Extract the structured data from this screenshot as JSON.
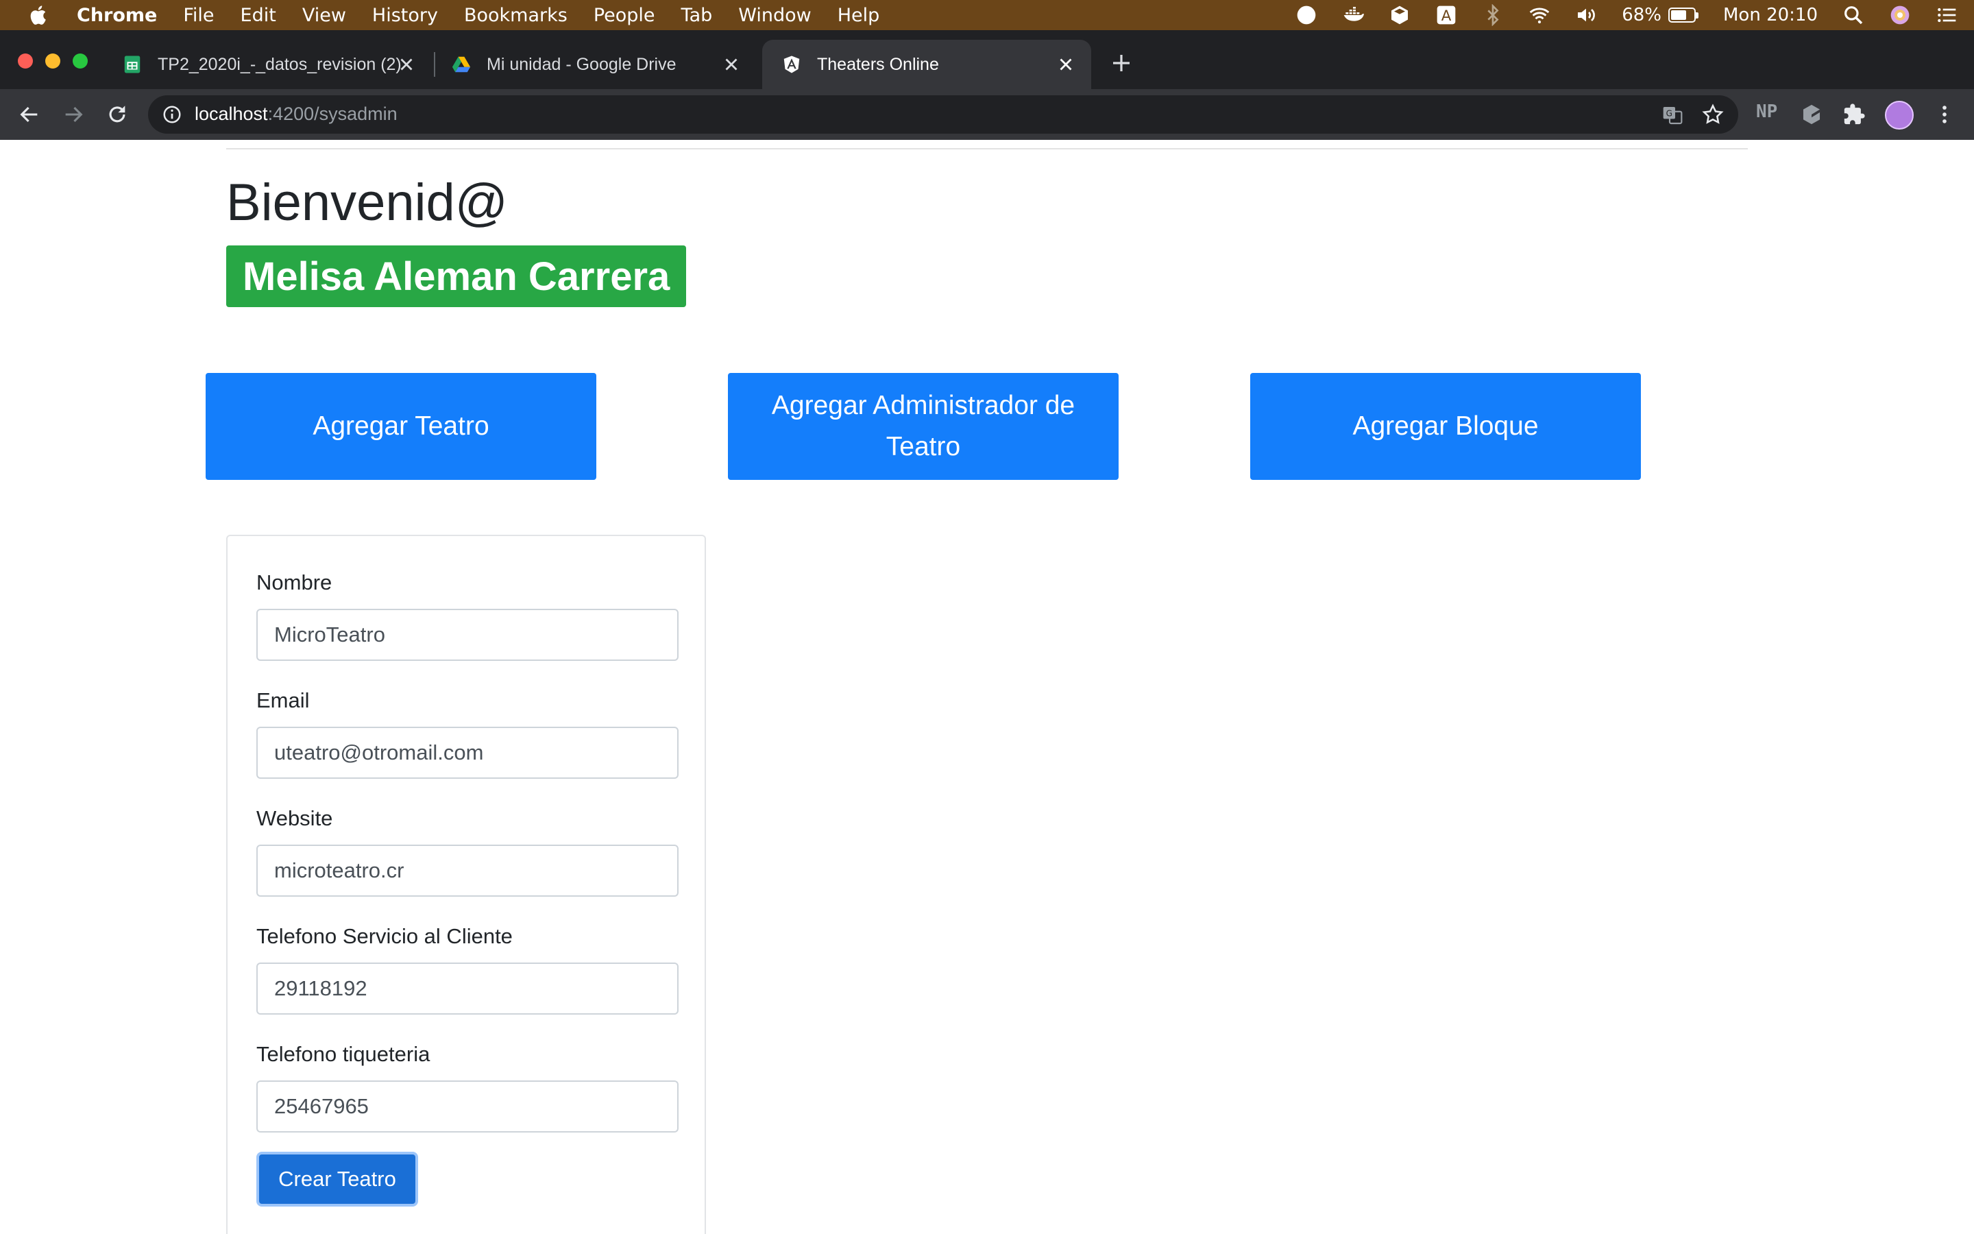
{
  "menubar": {
    "app": "Chrome",
    "items": [
      "File",
      "Edit",
      "View",
      "History",
      "Bookmarks",
      "People",
      "Tab",
      "Window",
      "Help"
    ],
    "battery_percent": "68%",
    "battery_level": 0.68,
    "clock": "Mon 20:10"
  },
  "browser": {
    "tabs": [
      {
        "title": "TP2_2020i_-_datos_revision (2)",
        "favicon": "google-sheets-icon"
      },
      {
        "title": "Mi unidad - Google Drive",
        "favicon": "google-drive-icon"
      },
      {
        "title": "Theaters Online",
        "favicon": "angular-icon",
        "active": true
      }
    ],
    "url_host": "localhost",
    "url_path": ":4200/sysadmin",
    "extension_label": "NP"
  },
  "page": {
    "welcome": "Bienvenid@",
    "user_name": "Melisa Aleman Carrera",
    "actions": {
      "add_theater": "Agregar Teatro",
      "add_admin": "Agregar Administrador de Teatro",
      "add_block": "Agregar Bloque"
    },
    "form": {
      "nombre_label": "Nombre",
      "nombre_value": "MicroTeatro",
      "email_label": "Email",
      "email_value": "uteatro@otromail.com",
      "website_label": "Website",
      "website_value": "microteatro.cr",
      "telefono_servicio_label": "Telefono Servicio al Cliente",
      "telefono_servicio_value": "29118192",
      "telefono_tiqueteria_label": "Telefono tiqueteria",
      "telefono_tiqueteria_value": "25467965",
      "submit_label": "Crear Teatro"
    }
  },
  "colors": {
    "menubar": "#6b4518",
    "primary": "#147efb",
    "success": "#28a745"
  }
}
